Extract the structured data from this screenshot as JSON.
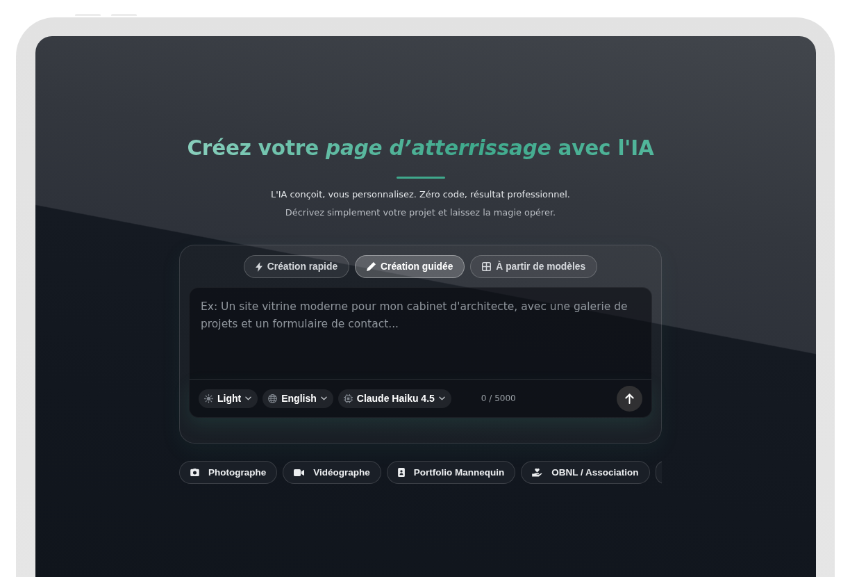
{
  "hero": {
    "title": "Créez votre *page d’atterrissage* avec l'IA",
    "subtitle": [
      "L'IA conçoit, vous personnalisez. Zéro code, résultat professionnel.",
      "Décrivez simplement votre projet et laissez la magie opérer."
    ]
  },
  "composer": {
    "modes": [
      {
        "label": "Création rapide",
        "selected": false
      },
      {
        "label": "Création guidée",
        "selected": true
      },
      {
        "label": "À partir de modèles",
        "selected": false
      }
    ],
    "prompt": {
      "placeholder": "Ex: Un site vitrine moderne pour mon cabinet d'architecte, avec une galerie de projets et un formulaire de contact..."
    },
    "options": [
      {
        "label": "Light"
      },
      {
        "label": "English"
      },
      {
        "label": "Claude Haiku 4.5"
      }
    ],
    "counter": "0 / 5000"
  },
  "suggestions": [
    {
      "label": "Photographe"
    },
    {
      "label": "Vidéographe"
    },
    {
      "label": "Portfolio Mannequin"
    },
    {
      "label": "OBNL / Association"
    }
  ],
  "suggestions_more": true
}
